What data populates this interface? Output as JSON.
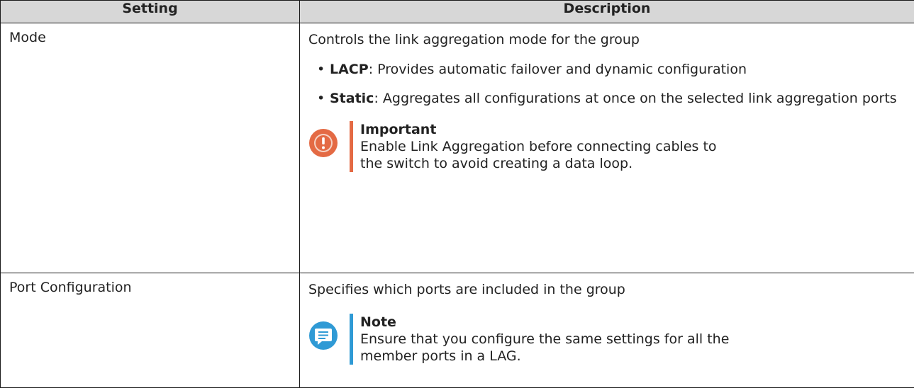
{
  "table": {
    "headers": [
      "Setting",
      "Description"
    ],
    "rows": [
      {
        "setting": "Mode",
        "description": "Controls the link aggregation mode for the group",
        "options": [
          {
            "name": "LACP",
            "text": ": Provides automatic failover and dynamic configuration"
          },
          {
            "name": "Static",
            "text": ": Aggregates all configurations at once on the selected link aggregation ports"
          }
        ],
        "callout": {
          "type": "important",
          "icon": "exclamation-icon",
          "color": "#e46a44",
          "title": "Important",
          "line1": "Enable Link Aggregation before connecting cables to",
          "line2": "the switch to avoid creating a data loop."
        }
      },
      {
        "setting": "Port Configuration",
        "description": "Specifies which ports are included in the group",
        "callout": {
          "type": "note",
          "icon": "note-icon",
          "color": "#2f9ad5",
          "title": "Note",
          "line1": "Ensure that you configure the same settings for all the",
          "line2": "member ports in a LAG."
        }
      }
    ]
  }
}
